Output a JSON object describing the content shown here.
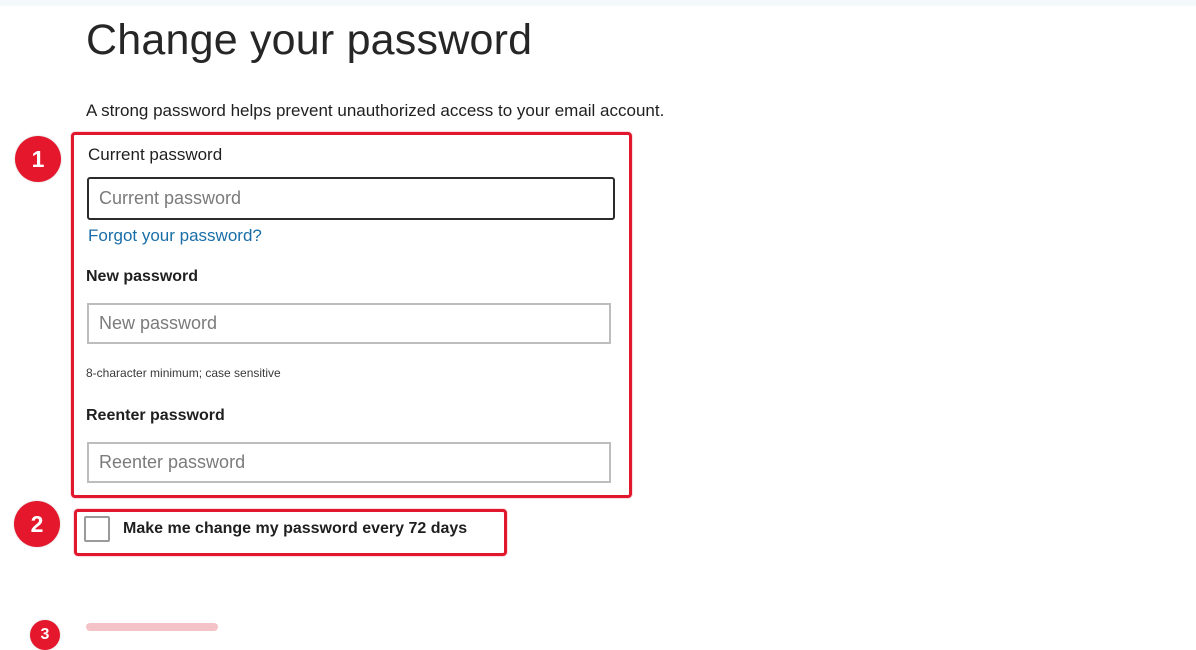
{
  "page": {
    "title": "Change your password",
    "intro": "A strong password helps prevent unauthorized access to your email account."
  },
  "markers": [
    "1",
    "2",
    "3"
  ],
  "current_password": {
    "label": "Current password",
    "placeholder": "Current password",
    "value": "",
    "forgot_link": "Forgot your password?"
  },
  "new_password": {
    "label": "New password",
    "placeholder": "New password",
    "value": "",
    "hint": "8-character minimum; case sensitive"
  },
  "reenter_password": {
    "label": "Reenter password",
    "placeholder": "Reenter password",
    "value": ""
  },
  "expiry_option": {
    "label": "Make me change my password every 72 days",
    "checked": false
  },
  "colors": {
    "highlight": "#e0172d",
    "link": "#1a6ea8"
  }
}
